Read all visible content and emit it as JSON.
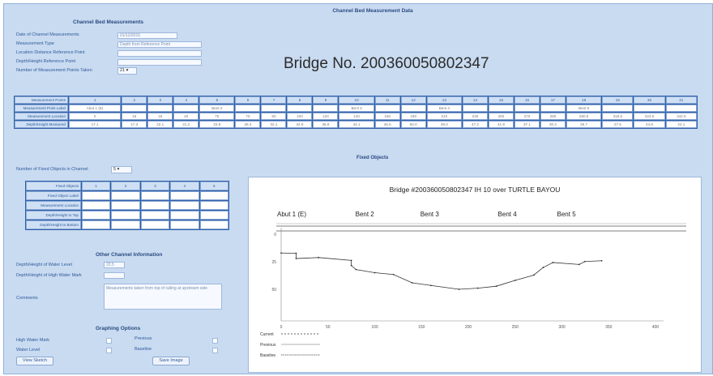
{
  "page_title": "Channel Bed Measurement Data",
  "channel_bed": {
    "heading": "Channel Bed Measurements",
    "date_label": "Date of Channel Measurements",
    "date_value": "01/12/2015",
    "type_label": "Measurement Type",
    "type_value": "Depth from Reference Point",
    "location_label": "Location Distance Reference Point",
    "height_label": "Depth/Height Reference Point",
    "count_label": "Number of Measurement Points Taken",
    "count_value": "21"
  },
  "bridge_title": "Bridge No. 200360050802347",
  "measure_table": {
    "row_labels": [
      "Measurement Points",
      "Measurement Point Label",
      "Measurement Location",
      "Depth/Height Measured"
    ],
    "points": [
      "1",
      "2",
      "3",
      "4",
      "5",
      "6",
      "7",
      "8",
      "9",
      "10",
      "11",
      "12",
      "13",
      "14",
      "15",
      "16",
      "17",
      "18",
      "19",
      "20",
      "21"
    ],
    "labels": [
      "Abut 1 (E)",
      "",
      "",
      "",
      "Bent 2",
      "",
      "",
      "",
      "",
      "Bent 3",
      "",
      "",
      "Bent 4",
      "",
      "",
      "",
      "",
      "Bent 5",
      "",
      "",
      ""
    ],
    "locations": [
      "0",
      "16",
      "16",
      "40",
      "75",
      "75",
      "80",
      "100",
      "120",
      "140",
      "160",
      "190",
      "210",
      "230",
      "250",
      "270",
      "280",
      "290.5",
      "318.5",
      "324.5",
      "342.5"
    ],
    "depths": [
      "17.1",
      "17.3",
      "22.1",
      "21.2",
      "23.8",
      "28.4",
      "32.1",
      "34.9",
      "36.6",
      "44.1",
      "46.5",
      "50.0",
      "49.0",
      "47.2",
      "41.9",
      "37.1",
      "30.2",
      "25.7",
      "27.5",
      "24.8",
      "24.1"
    ]
  },
  "fixed_objects": {
    "heading": "Fixed Objects",
    "count_label": "Number of Fixed Objects in Channel",
    "count_value": "5",
    "row_labels": [
      "Fixed Objects",
      "Fixed Object Label",
      "Measurement Location",
      "Depth/Height to Top",
      "Depth/Height to Bottom"
    ],
    "columns": [
      "1",
      "2",
      "3",
      "4",
      "5"
    ]
  },
  "other_info": {
    "heading": "Other Channel Information",
    "water_label": "Depth/Height of Water Level",
    "water_value": "22.5",
    "high_water_label": "Depth/Height of High Water Mark",
    "comments_label": "Comments",
    "comments_value": "Measurements taken from top of railing at upstream side"
  },
  "graphing": {
    "heading": "Graphing Options",
    "high_water_label": "High Water Mark",
    "previous_label": "Previous",
    "water_level_label": "Water Level",
    "baseline_label": "Baseline",
    "view_button": "View Sketch",
    "save_button": "Save Image"
  },
  "chart_data": {
    "type": "line",
    "title": "Bridge #200360050802347 IH 10 over TURTLE BAYOU",
    "bent_labels": [
      "Abut 1 (E)",
      "Bent 2",
      "Bent 3",
      "Bent 4",
      "Bent 5"
    ],
    "y_ticks": [
      0,
      25,
      50
    ],
    "x_ticks": [
      0,
      50,
      100,
      150,
      200,
      250,
      300,
      350,
      400
    ],
    "xlim": [
      0,
      400
    ],
    "ylim": [
      0,
      75
    ],
    "series": [
      {
        "name": "Current",
        "x": [
          0,
          16,
          16,
          40,
          75,
          75,
          80,
          100,
          120,
          140,
          160,
          190,
          210,
          230,
          250,
          270,
          280,
          290.5,
          318.5,
          324.5,
          342.5
        ],
        "y": [
          17.1,
          17.3,
          22.1,
          21.2,
          23.8,
          28.4,
          32.1,
          34.9,
          36.6,
          44.1,
          46.5,
          50.0,
          49.0,
          47.2,
          41.9,
          37.1,
          30.2,
          25.7,
          27.5,
          24.8,
          24.1
        ]
      }
    ],
    "legend": [
      "Current",
      "Previous",
      "Baseline"
    ],
    "legend_position": "bottom-left",
    "colors": {
      "line": "#333333",
      "deck": "#555555"
    }
  }
}
